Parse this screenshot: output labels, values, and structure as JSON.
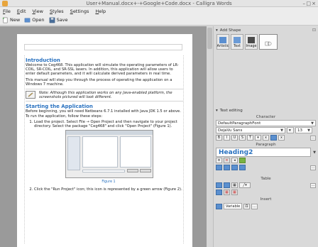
{
  "window": {
    "title": "User+Manual.docx+-+Google+Code.docx - Calligra Words"
  },
  "menu": [
    "File",
    "Edit",
    "View",
    "Styles",
    "Settings",
    "Help"
  ],
  "toolbar": {
    "new_label": "New",
    "open_label": "Open",
    "save_label": "Save"
  },
  "document": {
    "intro_heading": "Introduction",
    "intro_p1": "Welcome to Ceg468. This application will simulate the operating parameters of LR-COIL, SR-COIL, and SR-SSL lasers. In addition, this application will allow users to enter default parameters, and it will calculate derived parameters in real time.",
    "intro_p2": "This manual will step you through the process of operating the application on a Windows 7 machine.",
    "note_text": "Note: Although this application works on any Java-enabled platform, the screenshots pictured will look different.",
    "start_heading": "Starting the Application",
    "start_p": "Before beginning, you will need Netbeans 6.7.1 installed with Java JDK 1.5 or above. To run the application, follow these steps:",
    "step1": "Load the project. Select File → Open Project and then navigate to your project directory. Select the package \"Ceg468\" and click \"Open Project\" (Figure 1).",
    "figure_caption": "Figure 1",
    "step2": "Click the \"Run Project\" icon; this icon is represented by a green arrow (Figure 2)."
  },
  "dock": {
    "add_shape_title": "Add Shape",
    "shapes": [
      {
        "label": "Artistic"
      },
      {
        "label": "Text"
      },
      {
        "label": "Image"
      },
      {
        "label": ""
      }
    ],
    "text_editing_title": "Text editing",
    "character_label": "Character",
    "char_style": "DefaultParagraphFont",
    "font_family": "DejaVu Sans",
    "font_size": "13",
    "paragraph_label": "Paragraph",
    "para_style": "Heading2",
    "table_label": "Table",
    "insert_label": "Insert",
    "variable_label": "Variable"
  },
  "colors": {
    "heading": "#2a72c0",
    "canvas": "#9a9a9a",
    "panel": "#d9d9d9"
  }
}
